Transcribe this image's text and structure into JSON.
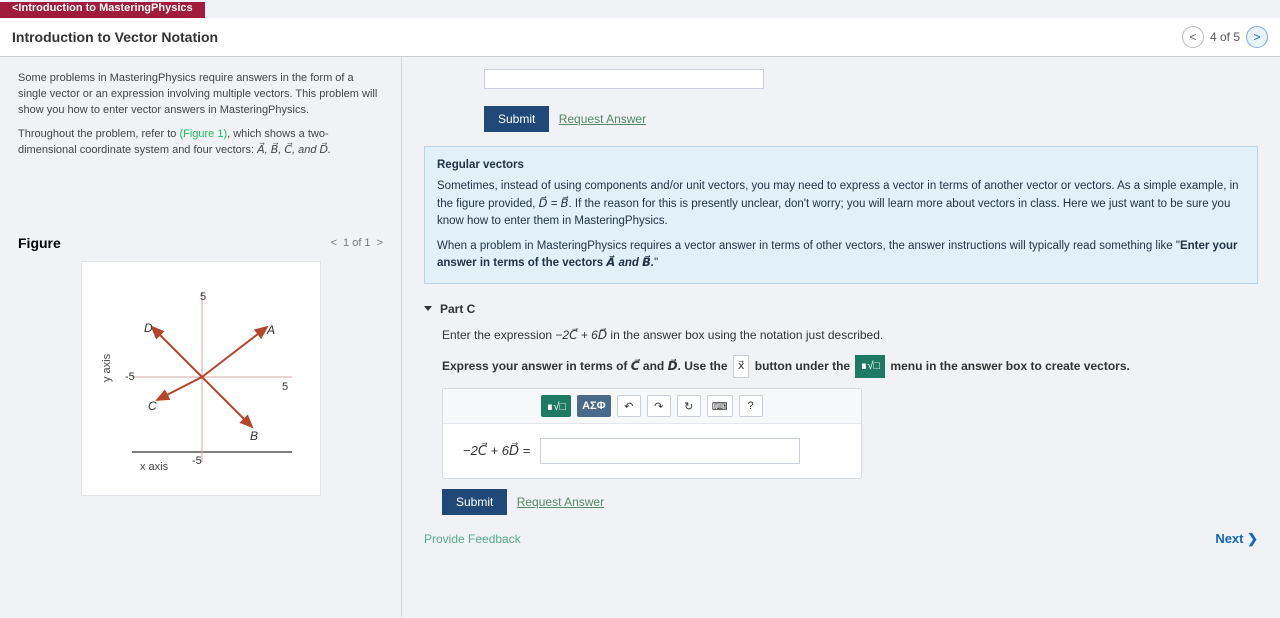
{
  "brand": "<Introduction to MasteringPhysics",
  "page_title": "Introduction to Vector Notation",
  "top_pager": {
    "label": "4 of 5"
  },
  "intro": {
    "p1": "Some problems in MasteringPhysics require answers in the form of a single vector or an expression involving multiple vectors. This problem will show you how to enter vector answers in MasteringPhysics.",
    "p2_a": "Throughout the problem, refer to ",
    "p2_link": "(Figure 1)",
    "p2_b": ", which shows a two-dimensional coordinate system and four vectors: ",
    "p2_c": "A⃗, B⃗, C⃗, and D⃗."
  },
  "figure": {
    "heading": "Figure",
    "pager": "1 of 1",
    "y_axis": "y axis",
    "x_axis": "x axis",
    "labels": {
      "A": "A⃗",
      "B": "B⃗",
      "C": "C⃗",
      "D": "D⃗"
    },
    "ticks": {
      "pos5": "5",
      "neg5": "-5"
    }
  },
  "top_submit": {
    "submit": "Submit",
    "request": "Request Answer"
  },
  "info": {
    "heading": "Regular vectors",
    "line1_a": "Sometimes, instead of using components and/or unit vectors, you may need to express a vector in terms of another vector or vectors. As a simple example, in the figure provided, ",
    "line1_eq": "D⃗ = B⃗",
    "line1_b": ". If the reason for this is presently unclear, don't worry; you will learn more about vectors in class. Here we just want to be sure you know how to enter them in MasteringPhysics.",
    "line2_a": "When a problem in MasteringPhysics requires a vector answer in terms of other vectors, the answer instructions will typically read something like \"",
    "line2_b": "Enter your answer in terms of the vectors ",
    "line2_c": "A⃗ and B⃗.",
    "line2_d": "\""
  },
  "part": {
    "label": "Part C",
    "prompt_a": "Enter the expression ",
    "prompt_eq": "−2C⃗ + 6D⃗",
    "prompt_b": " in the answer box using the notation just described.",
    "instr_a": "Express your answer in terms of ",
    "instr_b": "C⃗",
    "instr_c": " and ",
    "instr_d": "D⃗",
    "instr_e": ". Use the ",
    "instr_icon1": "x⃗",
    "instr_f": " button under the ",
    "instr_icon2": "∎√□",
    "instr_g": " menu in the answer box to create vectors."
  },
  "toolbar": {
    "vecmenu": "∎√□",
    "greek": "ΑΣΦ",
    "undo": "↶",
    "redo": "↷",
    "reset": "↻",
    "keyboard": "⌨",
    "help": "?"
  },
  "equation": {
    "label": "−2C⃗ + 6D⃗ ="
  },
  "bottom_submit": {
    "submit": "Submit",
    "request": "Request Answer"
  },
  "footer": {
    "feedback": "Provide Feedback",
    "next": "Next ❯"
  }
}
